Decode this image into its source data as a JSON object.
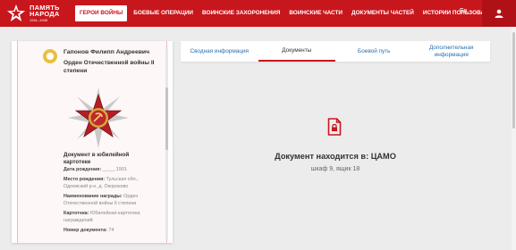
{
  "logo": {
    "line1": "ПАМЯТЬ",
    "line2": "НАРОДА",
    "years": "1941–1945"
  },
  "nav": {
    "items": [
      {
        "label": "ГЕРОИ ВОЙНЫ",
        "active": true
      },
      {
        "label": "БОЕВЫЕ ОПЕРАЦИИ",
        "active": false
      },
      {
        "label": "ВОИНСКИЕ ЗАХОРОНЕНИЯ",
        "active": false
      },
      {
        "label": "ВОИНСКИЕ ЧАСТИ",
        "active": false
      },
      {
        "label": "ДОКУМЕНТЫ ЧАСТЕЙ",
        "active": false
      },
      {
        "label": "ИСТОРИИ ПОЛЬЗОВАТЕЛЕЙ",
        "active": false
      }
    ],
    "lang": "En"
  },
  "card": {
    "name": "Гапонов Филипп Андреевич",
    "award": "Орден Отечественной войны II степени",
    "doc_type": "Документ в юбилейной картотеке",
    "fields": [
      {
        "label": "Дата рождения:",
        "value": "__.__.1901"
      },
      {
        "label": "Место рождения:",
        "value": "Тульская обл., Одоевский р-н, д. Окороково"
      },
      {
        "label": "Наименование награды:",
        "value": "Орден Отечественной войны II степени"
      },
      {
        "label": "Картотека:",
        "value": "Юбилейная картотека награждений"
      },
      {
        "label": "Номер документа:",
        "value": "74"
      }
    ]
  },
  "tabs": [
    {
      "label": "Сводная информация",
      "active": false
    },
    {
      "label": "Документы",
      "active": true
    },
    {
      "label": "Боевой путь",
      "active": false
    },
    {
      "label": "Дополнительная информация",
      "active": false
    }
  ],
  "document": {
    "location": "Документ находится в: ЦАМО",
    "shelf": "шкаф 9, ящик 18"
  },
  "colors": {
    "brand": "#c8161d",
    "link": "#2a6fb0"
  }
}
